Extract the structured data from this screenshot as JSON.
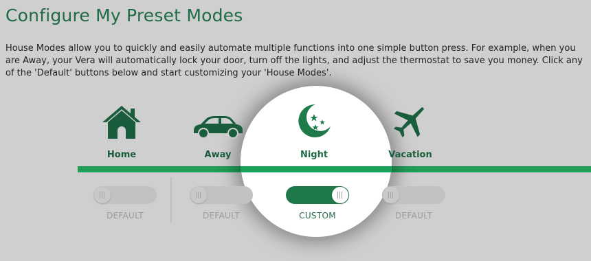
{
  "page": {
    "title": "Configure My Preset Modes",
    "description": "House Modes allow you to quickly and easily automate multiple functions into one simple button press. For example, when you are Away, your Vera will automatically lock your door, turn off the lights, and adjust the thermostat to save you money. Click any of the 'Default' buttons below and start customizing your 'House Modes'."
  },
  "colors": {
    "accent": "#1f9e57",
    "brand_dark": "#1f6b45",
    "background": "#cfcfcf"
  },
  "modes": [
    {
      "label": "Home",
      "icon": "house-icon",
      "toggle_label": "DEFAULT",
      "toggle_state": "off"
    },
    {
      "label": "Away",
      "icon": "car-icon",
      "toggle_label": "DEFAULT",
      "toggle_state": "off"
    },
    {
      "label": "Night",
      "icon": "moon-stars-icon",
      "toggle_label": "CUSTOM",
      "toggle_state": "on"
    },
    {
      "label": "Vacation",
      "icon": "airplane-icon",
      "toggle_label": "DEFAULT",
      "toggle_state": "off"
    }
  ]
}
